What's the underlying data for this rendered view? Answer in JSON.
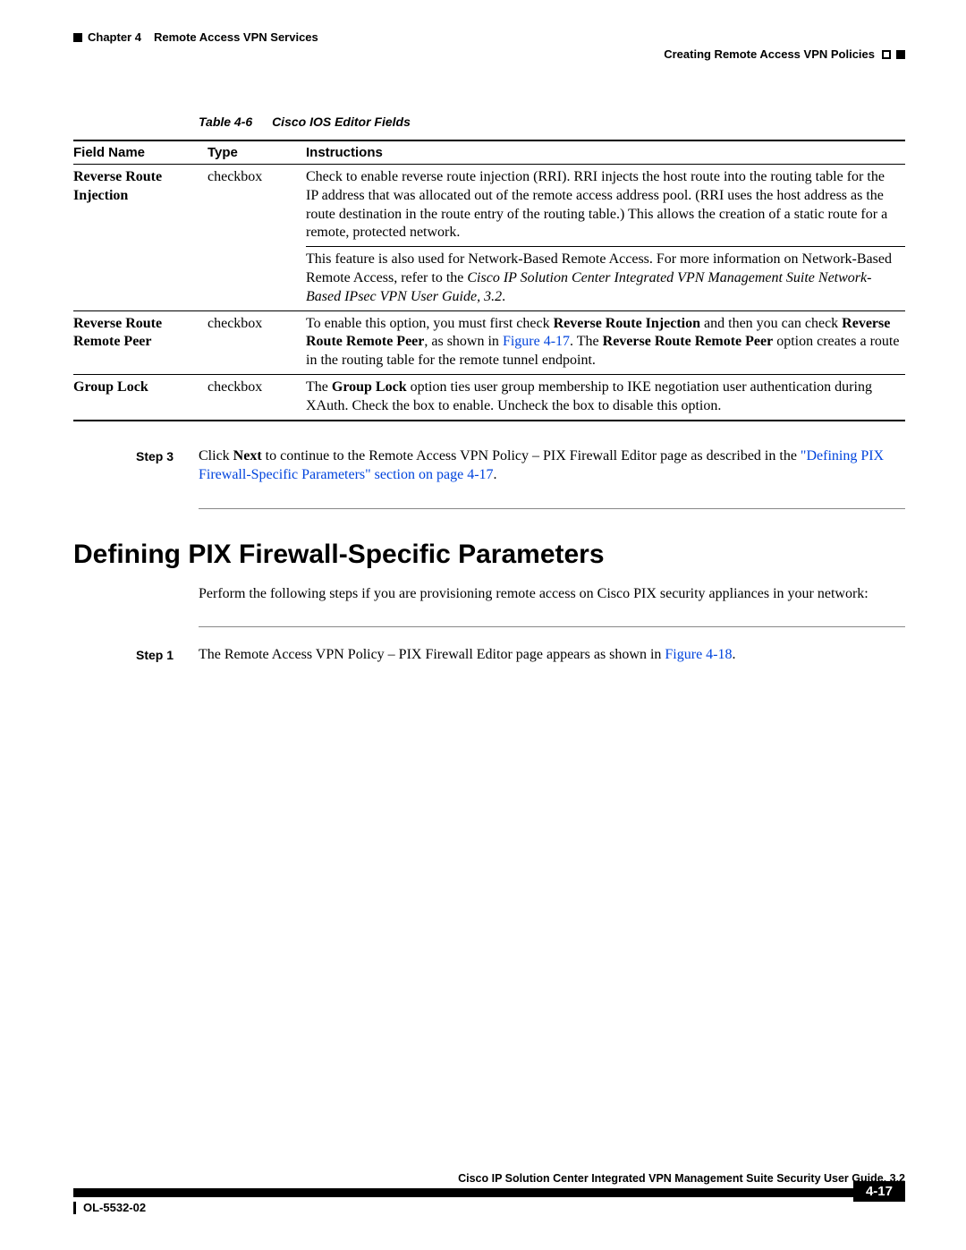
{
  "header": {
    "chapter_label": "Chapter 4",
    "chapter_title": "Remote Access VPN Services",
    "section_title": "Creating Remote Access VPN Policies"
  },
  "table_caption": {
    "number": "Table 4-6",
    "title": "Cisco IOS Editor Fields"
  },
  "table_headers": {
    "field": "Field Name",
    "type": "Type",
    "instructions": "Instructions"
  },
  "rows": {
    "rri": {
      "field": "Reverse Route Injection",
      "type": "checkbox",
      "para1": "Check to enable reverse route injection (RRI). RRI injects the host route into the routing table for the IP address that was allocated out of the remote access address pool. (RRI uses the host address as the route destination in the route entry of the routing table.) This allows the creation of a static route for a remote, protected network.",
      "para2_pre": "This feature is also used for Network-Based Remote Access. For more information on Network-Based Remote Access, refer to the ",
      "para2_italic": "Cisco IP Solution Center Integrated VPN Management Suite Network-Based IPsec VPN User Guide, 3.2",
      "para2_post": "."
    },
    "rrrp": {
      "field": "Reverse Route Remote Peer",
      "type": "checkbox",
      "t1": "To enable this option, you must first check ",
      "b1": "Reverse Route Injection",
      "t2": " and then you can check ",
      "b2": "Reverse Route Remote Peer",
      "t3": ", as shown in ",
      "link": "Figure 4-17",
      "t4": ". The ",
      "b3": "Reverse Route Remote Peer",
      "t5": " option creates a route in the routing table for the remote tunnel endpoint."
    },
    "gl": {
      "field": "Group Lock",
      "type": "checkbox",
      "t1": "The ",
      "b1": "Group Lock",
      "t2": " option ties user group membership to IKE negotiation user authentication during XAuth. Check the box to enable. Uncheck the box to disable this option."
    }
  },
  "step3": {
    "label": "Step 3",
    "t1": "Click ",
    "b1": "Next",
    "t2": " to continue to the Remote Access VPN Policy – PIX Firewall Editor page as described in the ",
    "link": "\"Defining PIX Firewall-Specific Parameters\" section on page 4-17",
    "t3": "."
  },
  "section_heading": "Defining PIX Firewall-Specific Parameters",
  "section_intro": "Perform the following steps if you are provisioning remote access on Cisco PIX security appliances in your network:",
  "step1": {
    "label": "Step 1",
    "t1": "The Remote Access VPN Policy – PIX Firewall Editor page appears as shown in ",
    "link": "Figure 4-18",
    "t2": "."
  },
  "footer": {
    "guide": "Cisco IP Solution Center Integrated VPN Management Suite Security User Guide, 3.2",
    "doc_id": "OL-5532-02",
    "page": "4-17"
  }
}
